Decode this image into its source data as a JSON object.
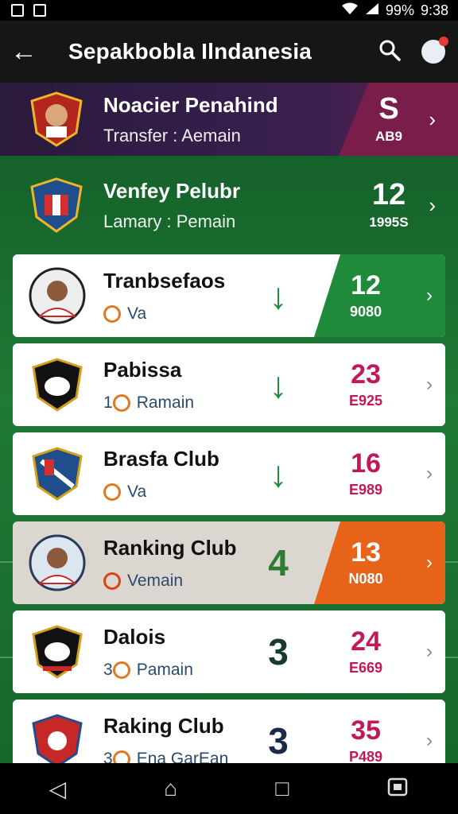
{
  "status": {
    "battery": "99%",
    "time": "9:38"
  },
  "appbar": {
    "title": "Sepakbobla Ilndanesia",
    "back_glyph": "←"
  },
  "hero": [
    {
      "name": "Noacier Penahind",
      "sub": "Transfer : Aemain",
      "score": "S",
      "detail": "AB9"
    },
    {
      "name": "Venfey Pelubr",
      "sub": "Lamary : Pemain",
      "score": "12",
      "detail": "1995S"
    }
  ],
  "cards": [
    {
      "name": "Tranbsefaos",
      "sub": "Va",
      "trend": "↓",
      "score": "12",
      "detail": "9080",
      "style": "hl-green"
    },
    {
      "name": "Pabissa",
      "sub_prefix": "1",
      "sub": "Ramain",
      "trend": "↓",
      "score": "23",
      "detail": "E925",
      "style": "red"
    },
    {
      "name": "Brasfa Club",
      "sub": "Va",
      "trend": "↓",
      "score": "16",
      "detail": "E989",
      "style": "red"
    },
    {
      "name": "Ranking Club",
      "sub": "Vemain",
      "trend": "4",
      "score": "13",
      "detail": "N080",
      "style": "hl-orange"
    },
    {
      "name": "Dalois",
      "sub_prefix": "3",
      "sub": "Pamain",
      "trend": "3",
      "score": "24",
      "detail": "E669",
      "style": "red"
    },
    {
      "name": "Raking Club",
      "sub_prefix": "3",
      "sub": "Ena GarEan",
      "trend": "3",
      "score": "35",
      "detail": "P489",
      "style": "red"
    }
  ],
  "colors": {
    "green_panel": "#1e8a3a",
    "orange_panel": "#e8631a",
    "score_red": "#c2185b"
  },
  "navbar": {
    "back": "◁",
    "home": "⌂",
    "recents": "□"
  }
}
